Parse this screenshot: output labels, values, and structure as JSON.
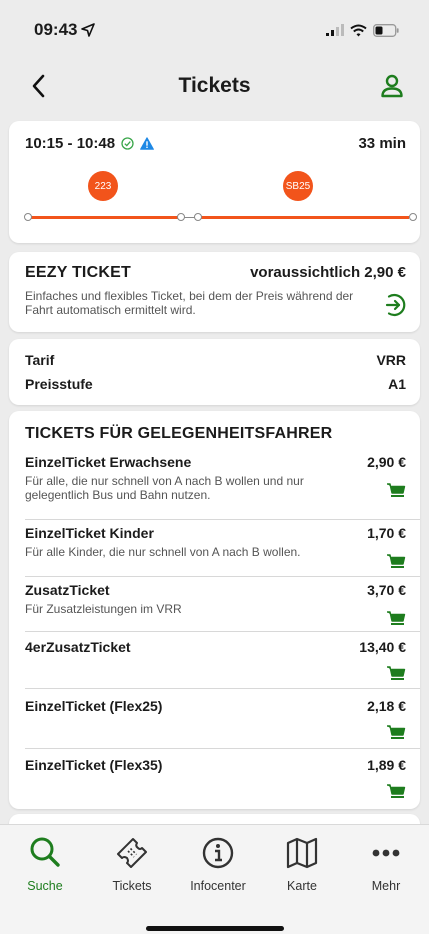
{
  "status_bar": {
    "time": "09:43"
  },
  "nav": {
    "title": "Tickets"
  },
  "connection": {
    "times": "10:15 - 10:48",
    "duration": "33 min",
    "lines": [
      "223",
      "SB25"
    ]
  },
  "eezy": {
    "title": "EEZY TICKET",
    "price": "voraussichtlich 2,90 €",
    "description": "Einfaches und flexibles Ticket, bei dem der Preis während der Fahrt automatisch ermittelt wird."
  },
  "tarif": {
    "rows": [
      {
        "label": "Tarif",
        "value": "VRR"
      },
      {
        "label": "Preisstufe",
        "value": "A1"
      }
    ]
  },
  "tickets": {
    "section_title": "TICKETS FÜR GELEGENHEITSFAHRER",
    "items": [
      {
        "name": "EinzelTicket Erwachsene",
        "price": "2,90 €",
        "description": "Für alle, die nur schnell von A nach B wollen und nur gelegentlich Bus und Bahn nutzen."
      },
      {
        "name": "EinzelTicket Kinder",
        "price": "1,70 €",
        "description": "Für alle Kinder, die nur schnell von A nach B wollen."
      },
      {
        "name": "ZusatzTicket",
        "price": "3,70 €",
        "description": "Für Zusatzleistungen im VRR"
      },
      {
        "name": "4erZusatzTicket",
        "price": "13,40 €",
        "description": ""
      },
      {
        "name": "EinzelTicket (Flex25)",
        "price": "2,18 €",
        "description": ""
      },
      {
        "name": "EinzelTicket (Flex35)",
        "price": "1,89 €",
        "description": ""
      }
    ]
  },
  "tab_bar": {
    "items": [
      {
        "label": "Suche",
        "icon": "search-icon"
      },
      {
        "label": "Tickets",
        "icon": "ticket-icon"
      },
      {
        "label": "Infocenter",
        "icon": "info-icon"
      },
      {
        "label": "Karte",
        "icon": "map-icon"
      },
      {
        "label": "Mehr",
        "icon": "more-icon"
      }
    ]
  },
  "colors": {
    "accent_green": "#1e7d1e",
    "line_orange": "#f2541b",
    "status_check": "#3aa64a",
    "status_warning": "#1e88e5"
  }
}
